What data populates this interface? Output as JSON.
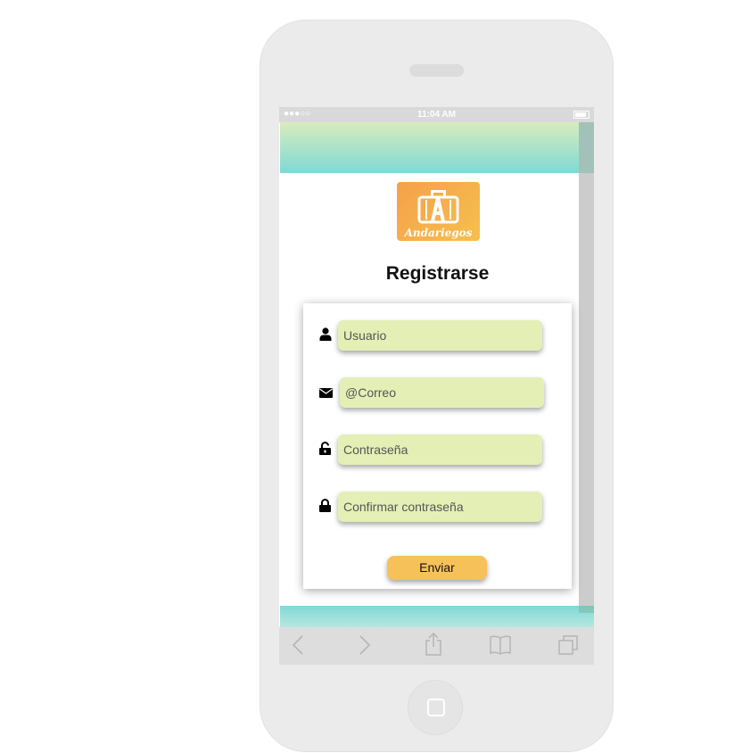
{
  "status_bar": {
    "signal": "●●●○○",
    "time": "11:04 AM"
  },
  "logo": {
    "text": "Andariegos"
  },
  "page": {
    "title": "Registrarse"
  },
  "form": {
    "usuario_placeholder": "Usuario",
    "correo_placeholder": "@Correo",
    "contrasena_placeholder": "Contraseña",
    "confirmar_placeholder": "Confirmar contraseña",
    "submit_label": "Enviar"
  },
  "icons": {
    "usuario": "user-icon",
    "correo": "envelope-icon",
    "contrasena": "unlock-icon",
    "confirmar": "lock-icon",
    "browser": [
      "back-icon",
      "forward-icon",
      "share-icon",
      "bookmarks-icon",
      "tabs-icon"
    ]
  },
  "colors": {
    "field_bg": "#e4efb6",
    "button_bg": "#f7c15a",
    "header_gradient_top": "#d8ecbd",
    "header_gradient_bottom": "#7fd9d6",
    "logo_gradient": "#f6a049"
  }
}
